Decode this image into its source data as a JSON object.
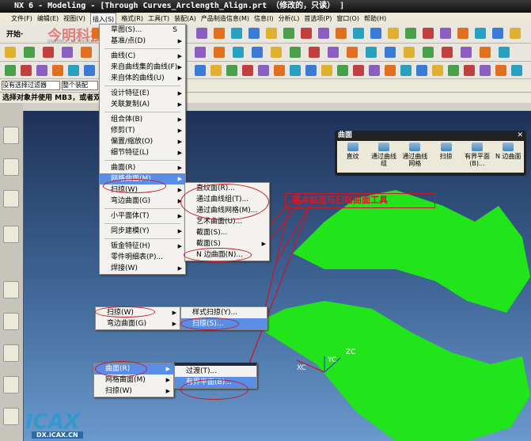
{
  "title": "NX 6 - Modeling - [Through Curves_Arclength_Align.prt （修改的，只读） ]",
  "menubar": [
    "文件(F)",
    "编辑(E)",
    "视图(V)",
    "插入(S)",
    "格式(R)",
    "工具(T)",
    "装配(A)",
    "产品制造信息(M)",
    "信息(I)",
    "分析(L)",
    "首选项(P)",
    "窗口(O)",
    "帮助(H)"
  ],
  "toolbar": {
    "start": "开始·",
    "watermark": "今明科技",
    "watermark_sub": "JINMING TECHNOLOGY"
  },
  "filter": {
    "selection_filter": "没有选择过滤器",
    "scope": "整个装配"
  },
  "status": "选择对象并使用 MB3，或者双击",
  "insert_menu": [
    {
      "label": "草图(S)...",
      "shortcut": "S"
    },
    {
      "label": "基准/点(D)",
      "sub": true
    },
    "-",
    {
      "label": "曲线(C)",
      "sub": true
    },
    {
      "label": "来自曲线集的曲线(F)",
      "sub": true
    },
    {
      "label": "来自体的曲线(U)",
      "sub": true
    },
    "-",
    {
      "label": "设计特征(E)",
      "sub": true
    },
    {
      "label": "关联复制(A)",
      "sub": true
    },
    "-",
    {
      "label": "组合体(B)",
      "sub": true
    },
    {
      "label": "修剪(T)",
      "sub": true
    },
    {
      "label": "偏置/缩放(O)",
      "sub": true
    },
    {
      "label": "细节特征(L)",
      "sub": true
    },
    "-",
    {
      "label": "曲面(R)",
      "sub": true
    },
    {
      "label": "网格曲面(M)",
      "sub": true,
      "hl": true
    },
    {
      "label": "扫掠(W)",
      "sub": true
    },
    {
      "label": "弯边曲面(G)",
      "sub": true
    },
    "-",
    {
      "label": "小平面体(T)",
      "sub": true
    },
    "-",
    {
      "label": "同步建模(Y)",
      "sub": true
    },
    "-",
    {
      "label": "钣金特征(H)",
      "sub": true
    },
    {
      "label": "零件明细表(P)..."
    },
    {
      "label": "焊接(W)",
      "sub": true
    }
  ],
  "mesh_submenu": [
    {
      "label": "直纹面(R)..."
    },
    {
      "label": "通过曲线组(T)..."
    },
    {
      "label": "通过曲线网格(M)..."
    },
    {
      "label": "艺术曲面(U)..."
    },
    {
      "label": "截面(S)..."
    },
    {
      "label": "截面(S)",
      "sub": true
    },
    {
      "label": "N 边曲面(N)..."
    }
  ],
  "sweep_menu": [
    {
      "label": "扫掠(W)",
      "sub": true
    },
    {
      "label": "弯边曲面(G)",
      "sub": true
    }
  ],
  "sweep_submenu": [
    {
      "label": "样式扫掠(Y)..."
    },
    {
      "label": "扫掠(S)...",
      "hl": true
    }
  ],
  "surface_menu": [
    {
      "label": "曲面(R)",
      "sub": true,
      "hl": true
    },
    {
      "label": "网格曲面(M)",
      "sub": true
    },
    {
      "label": "扫掠(W)",
      "sub": true
    }
  ],
  "surface_submenu": [
    {
      "label": "过渡(T)..."
    },
    {
      "label": "有界平面(B)...",
      "hl": true
    }
  ],
  "panel": {
    "title": "曲面",
    "buttons": [
      "直纹",
      "通过曲线组",
      "通过曲线网格",
      "扫掠",
      "有界平面(B)...",
      "N 边曲面"
    ]
  },
  "callout": "基本曲面与扫略曲面工具",
  "axes": {
    "x": "XC",
    "y": "YC",
    "z": "ZC"
  },
  "logo": "DX.ICAX.CN",
  "colors": {
    "accent": "#5a8ee6",
    "annotation": "#c41a2a",
    "surface": "#22e41a"
  }
}
